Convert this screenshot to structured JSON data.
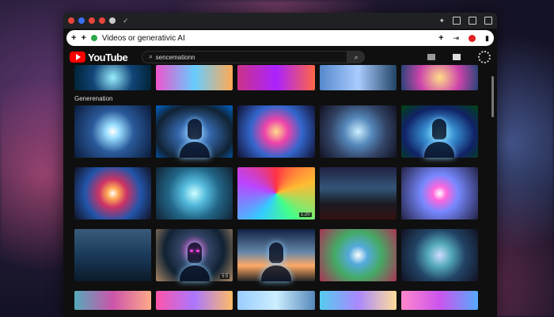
{
  "browser": {
    "tab_dots": [
      "#e8453c",
      "#3b6ef5",
      "#e8453c",
      "#e8453c",
      "#cccccc"
    ],
    "url_text": "Videos or generativic AI"
  },
  "youtube": {
    "logo_text": "YouTube",
    "search_value": "sencemationn"
  },
  "section": {
    "title": "Generenation"
  },
  "thumbnails": {
    "row2_badges": [
      "",
      "",
      "",
      "",
      ""
    ],
    "row3_badges": [
      "",
      "",
      "1:20",
      "",
      ""
    ],
    "row4_badges": [
      "",
      "5:5",
      "",
      "",
      ""
    ]
  },
  "icons": {
    "check": "✓",
    "plus": "+",
    "search": "⌕",
    "magnifier": "🔍",
    "star": "✦"
  },
  "colors": {
    "accent": "#ff0000",
    "background": "#0f0f0f"
  }
}
